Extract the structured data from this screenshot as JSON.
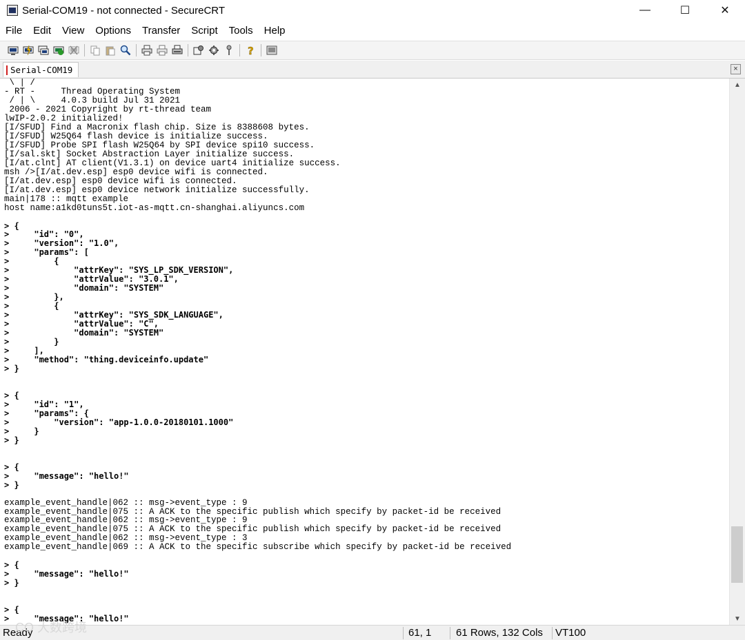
{
  "window": {
    "title": "Serial-COM19 - not connected - SecureCRT",
    "minimize": "—",
    "maximize": "☐",
    "close": "✕"
  },
  "menu": {
    "items": [
      "File",
      "Edit",
      "View",
      "Options",
      "Transfer",
      "Script",
      "Tools",
      "Help"
    ]
  },
  "toolbar": {
    "icons": [
      "connect-icon",
      "quick-connect-icon",
      "connect-tab-icon",
      "reconnect-icon",
      "disconnect-icon",
      "copy-icon",
      "paste-icon",
      "find-icon",
      "print-icon",
      "print-selection-icon",
      "print-setup-icon",
      "session-options-icon",
      "global-options-icon",
      "keymap-icon",
      "help-icon",
      "screen-icon"
    ]
  },
  "tab": {
    "label": "Serial-COM19",
    "close": "×"
  },
  "terminal": {
    "lines": [
      " \\ | /",
      "- RT -     Thread Operating System",
      " / | \\     4.0.3 build Jul 31 2021",
      " 2006 - 2021 Copyright by rt-thread team",
      "lwIP-2.0.2 initialized!",
      "[I/SFUD] Find a Macronix flash chip. Size is 8388608 bytes.",
      "[I/SFUD] W25Q64 flash device is initialize success.",
      "[I/SFUD] Probe SPI flash W25Q64 by SPI device spi10 success.",
      "[I/sal.skt] Socket Abstraction Layer initialize success.",
      "[I/at.clnt] AT client(V1.3.1) on device uart4 initialize success.",
      "msh />[I/at.dev.esp] esp0 device wifi is connected.",
      "[I/at.dev.esp] esp0 device wifi is connected.",
      "[I/at.dev.esp] esp0 device network initialize successfully.",
      "main|178 :: mqtt example",
      "host name:a1kd0tuns5t.iot-as-mqtt.cn-shanghai.aliyuncs.com",
      "",
      "> {",
      ">     \"id\": \"0\",",
      ">     \"version\": \"1.0\",",
      ">     \"params\": [",
      ">         {",
      ">             \"attrKey\": \"SYS_LP_SDK_VERSION\",",
      ">             \"attrValue\": \"3.0.1\",",
      ">             \"domain\": \"SYSTEM\"",
      ">         },",
      ">         {",
      ">             \"attrKey\": \"SYS_SDK_LANGUAGE\",",
      ">             \"attrValue\": \"C\",",
      ">             \"domain\": \"SYSTEM\"",
      ">         }",
      ">     ],",
      ">     \"method\": \"thing.deviceinfo.update\"",
      "> }",
      "",
      "",
      "> {",
      ">     \"id\": \"1\",",
      ">     \"params\": {",
      ">         \"version\": \"app-1.0.0-20180101.1000\"",
      ">     }",
      "> }",
      "",
      "",
      "> {",
      ">     \"message\": \"hello!\"",
      "> }",
      "",
      "example_event_handle|062 :: msg->event_type : 9",
      "example_event_handle|075 :: A ACK to the specific publish which specify by packet-id be received",
      "example_event_handle|062 :: msg->event_type : 9",
      "example_event_handle|075 :: A ACK to the specific publish which specify by packet-id be received",
      "example_event_handle|062 :: msg->event_type : 3",
      "example_event_handle|069 :: A ACK to the specific subscribe which specify by packet-id be received",
      "",
      "> {",
      ">     \"message\": \"hello!\"",
      "> }",
      "",
      "",
      "> {",
      ">     \"message\": \"hello!\""
    ]
  },
  "scrollbar": {
    "up": "▲",
    "down": "▼"
  },
  "status": {
    "state": "Ready",
    "cursor": "61,   1",
    "size": "61 Rows, 132 Cols",
    "emulation": "VT100",
    "watermark": "CO 大数跨境"
  }
}
